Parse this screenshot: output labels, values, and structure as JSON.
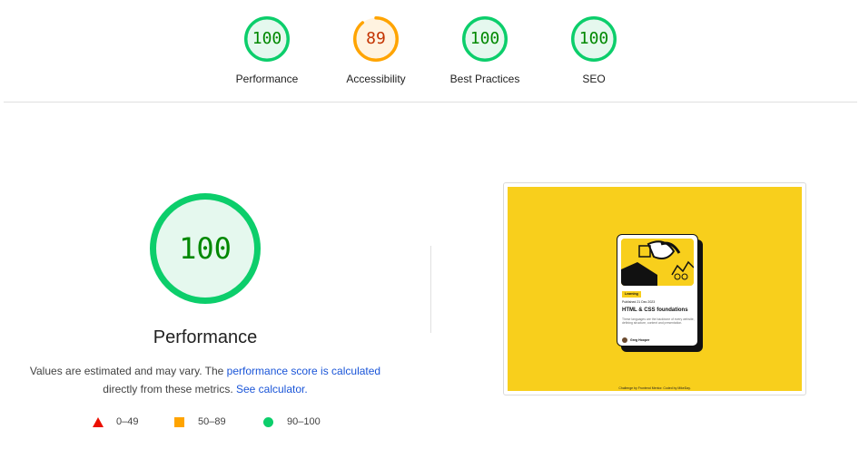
{
  "categories": [
    {
      "label": "Performance",
      "score": "100",
      "value": 100,
      "color": "#0cce6b",
      "bg": "#e5f8ee",
      "status": "pass"
    },
    {
      "label": "Accessibility",
      "score": "89",
      "value": 89,
      "color": "#ffa400",
      "bg": "#fff3e0",
      "status": "avg"
    },
    {
      "label": "Best Practices",
      "score": "100",
      "value": 100,
      "color": "#0cce6b",
      "bg": "#e5f8ee",
      "status": "pass"
    },
    {
      "label": "SEO",
      "score": "100",
      "value": 100,
      "color": "#0cce6b",
      "bg": "#e5f8ee",
      "status": "pass"
    }
  ],
  "performance": {
    "score": "100",
    "value": 100,
    "title": "Performance",
    "desc_prefix": "Values are estimated and may vary. The ",
    "desc_link1": "performance score is calculated",
    "desc_middle": " directly from these metrics. ",
    "desc_link2": "See calculator."
  },
  "legend": {
    "fail": "0–49",
    "average": "50–89",
    "pass": "90–100"
  },
  "screenshot": {
    "tag": "Learning",
    "date": "Published 21 Dec 2023",
    "title": "HTML & CSS foundations",
    "text": "These languages are the backbone of every website, defining structure, content and presentation.",
    "author": "Greg Hooper",
    "attribution": "Challenge by Frontend Mentor. Coded by MikeDay."
  },
  "colors": {
    "pass": "#0cce6b",
    "average": "#ffa400",
    "fail": "#eb0f00",
    "link": "#1a55d8",
    "card_bg": "#f8cf1c"
  }
}
